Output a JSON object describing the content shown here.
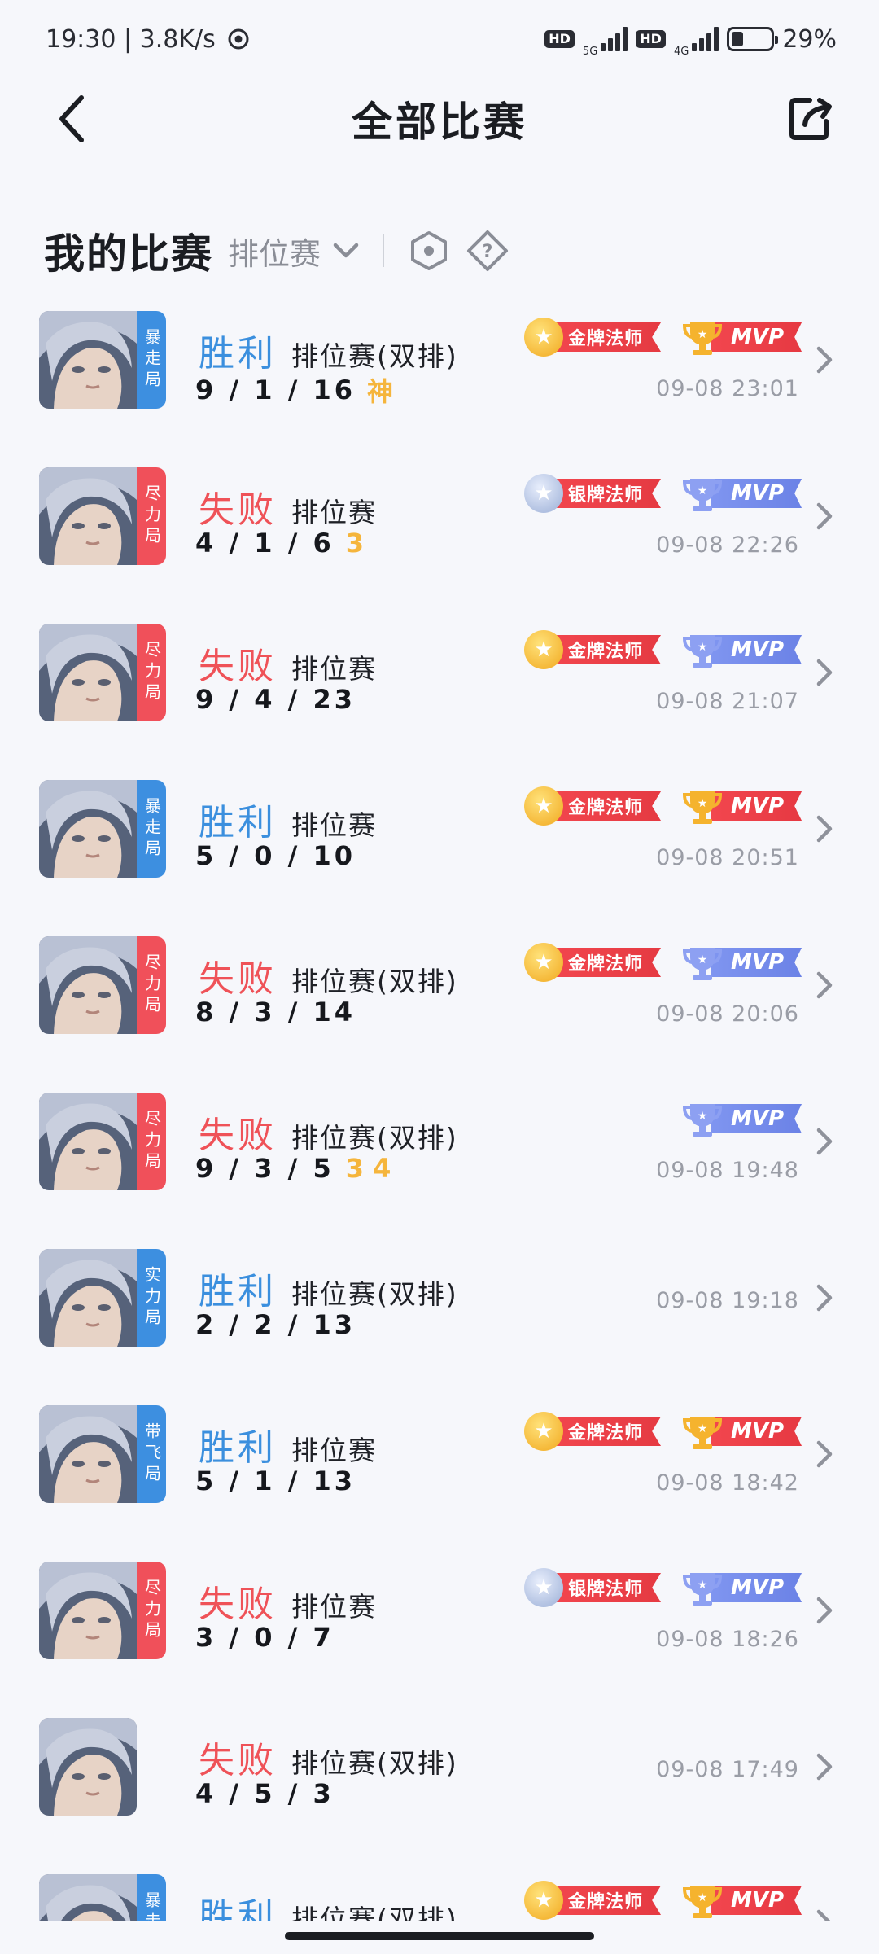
{
  "status_bar": {
    "time_speed": "19:30 | 3.8K/s",
    "hd1": "HD",
    "net1": "5G",
    "hd2": "HD",
    "net2": "4G",
    "battery": "29%",
    "battery_level": 0.29
  },
  "header": {
    "title": "全部比赛"
  },
  "section": {
    "title": "我的比赛",
    "filter": "排位赛"
  },
  "matches": [
    {
      "result": "胜利",
      "outcome": "win",
      "mode": "排位赛(双排)",
      "kda": "9 / 1 / 16",
      "medal": "神",
      "tag": "暴走局",
      "tag_color": "blue",
      "title_badge": "金牌法师",
      "title_type": "gold",
      "mvp": "MVP",
      "mvp_type": "gold",
      "time": "09-08 23:01"
    },
    {
      "result": "失败",
      "outcome": "lose",
      "mode": "排位赛",
      "kda": "4 / 1 / 6",
      "medal": "3",
      "tag": "尽力局",
      "tag_color": "red",
      "title_badge": "银牌法师",
      "title_type": "silver",
      "mvp": "MVP",
      "mvp_type": "silver",
      "time": "09-08 22:26"
    },
    {
      "result": "失败",
      "outcome": "lose",
      "mode": "排位赛",
      "kda": "9 / 4 / 23",
      "medal": "",
      "tag": "尽力局",
      "tag_color": "red",
      "title_badge": "金牌法师",
      "title_type": "gold",
      "mvp": "MVP",
      "mvp_type": "silver",
      "time": "09-08 21:07"
    },
    {
      "result": "胜利",
      "outcome": "win",
      "mode": "排位赛",
      "kda": "5 / 0 / 10",
      "medal": "",
      "tag": "暴走局",
      "tag_color": "blue",
      "title_badge": "金牌法师",
      "title_type": "gold",
      "mvp": "MVP",
      "mvp_type": "gold",
      "time": "09-08 20:51"
    },
    {
      "result": "失败",
      "outcome": "lose",
      "mode": "排位赛(双排)",
      "kda": "8 / 3 / 14",
      "medal": "",
      "tag": "尽力局",
      "tag_color": "red",
      "title_badge": "金牌法师",
      "title_type": "gold",
      "mvp": "MVP",
      "mvp_type": "silver",
      "time": "09-08 20:06"
    },
    {
      "result": "失败",
      "outcome": "lose",
      "mode": "排位赛(双排)",
      "kda": "9 / 3 / 5",
      "medal": "3 4",
      "tag": "尽力局",
      "tag_color": "red",
      "title_badge": "",
      "title_type": "",
      "mvp": "MVP",
      "mvp_type": "silver",
      "time": "09-08 19:48"
    },
    {
      "result": "胜利",
      "outcome": "win",
      "mode": "排位赛(双排)",
      "kda": "2 / 2 / 13",
      "medal": "",
      "tag": "实力局",
      "tag_color": "blue",
      "title_badge": "",
      "title_type": "",
      "mvp": "",
      "mvp_type": "",
      "time": "09-08 19:18"
    },
    {
      "result": "胜利",
      "outcome": "win",
      "mode": "排位赛",
      "kda": "5 / 1 / 13",
      "medal": "",
      "tag": "带飞局",
      "tag_color": "blue",
      "title_badge": "金牌法师",
      "title_type": "gold",
      "mvp": "MVP",
      "mvp_type": "gold",
      "time": "09-08 18:42"
    },
    {
      "result": "失败",
      "outcome": "lose",
      "mode": "排位赛",
      "kda": "3 / 0 / 7",
      "medal": "",
      "tag": "尽力局",
      "tag_color": "red",
      "title_badge": "银牌法师",
      "title_type": "silver",
      "mvp": "MVP",
      "mvp_type": "silver",
      "time": "09-08 18:26"
    },
    {
      "result": "失败",
      "outcome": "lose",
      "mode": "排位赛(双排)",
      "kda": "4 / 5 / 3",
      "medal": "",
      "tag": "",
      "tag_color": "",
      "title_badge": "",
      "title_type": "",
      "mvp": "",
      "mvp_type": "",
      "time": "09-08 17:49"
    },
    {
      "result": "胜利",
      "outcome": "win",
      "mode": "排位赛(双排)",
      "kda": "",
      "medal": "",
      "tag": "暴走局",
      "tag_color": "blue",
      "title_badge": "金牌法师",
      "title_type": "gold",
      "mvp": "MVP",
      "mvp_type": "gold",
      "time": ""
    }
  ],
  "icons": {
    "back": "back-arrow-icon",
    "share": "share-icon",
    "filter": "chevron-down-icon",
    "hero_filter": "hexagon-icon",
    "help": "help-icon",
    "row": "chevron-right-icon"
  }
}
